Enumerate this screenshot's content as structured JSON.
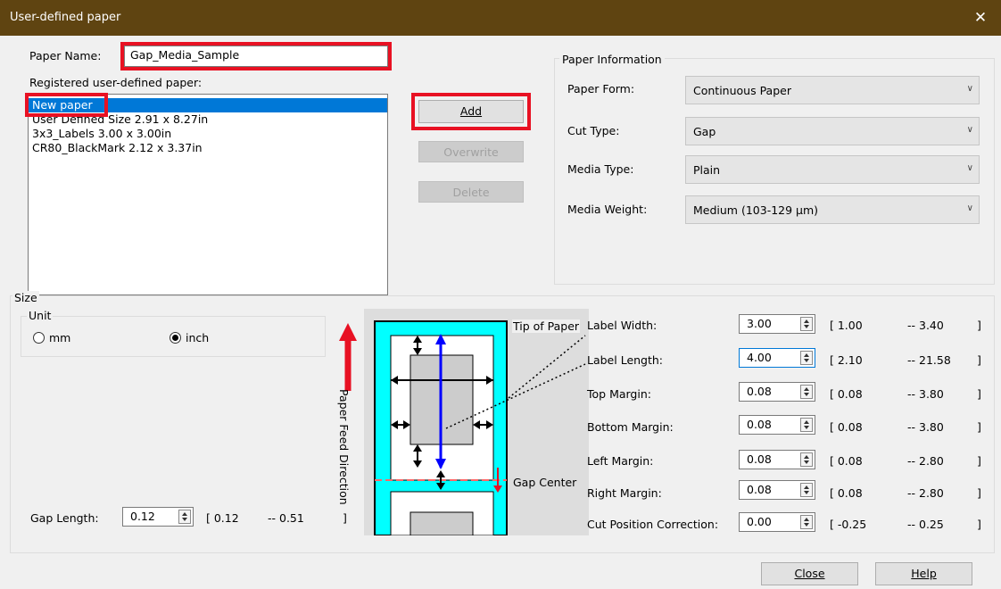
{
  "window": {
    "title": "User-defined paper",
    "close_glyph": "✕"
  },
  "paper_name": {
    "label": "Paper Name:",
    "value": "Gap_Media_Sample"
  },
  "registered": {
    "label": "Registered user-defined paper:",
    "items": [
      "New paper",
      "User Defined Size 2.91 x 8.27in",
      "3x3_Labels 3.00 x 3.00in",
      "CR80_BlackMark 2.12 x 3.37in"
    ]
  },
  "buttons": {
    "add": "Add",
    "overwrite": "Overwrite",
    "delete": "Delete",
    "close": "Close",
    "help": "Help"
  },
  "paper_info": {
    "title": "Paper Information",
    "paper_form": {
      "label": "Paper Form:",
      "value": "Continuous Paper"
    },
    "cut_type": {
      "label": "Cut Type:",
      "value": "Gap"
    },
    "media_type": {
      "label": "Media Type:",
      "value": "Plain"
    },
    "media_weight": {
      "label": "Media Weight:",
      "value": "Medium (103-129 μm)"
    }
  },
  "size": {
    "title": "Size",
    "unit": {
      "title": "Unit",
      "mm": "mm",
      "inch": "inch",
      "selected": "inch"
    },
    "gap_length": {
      "label": "Gap Length:",
      "value": "0.12",
      "min": "[  0.12",
      "max": "--  0.51",
      "close": "]"
    }
  },
  "diagram": {
    "tip_of_paper": "Tip of Paper",
    "gap_center": "Gap Center",
    "feed_direction": "Paper Feed Direction",
    "feed_color": "#e81123",
    "label_color": "#00ffff"
  },
  "fields": [
    {
      "label": "Label Width:",
      "value": "3.00",
      "min": "[  1.00",
      "max": "--  3.40",
      "close": "]"
    },
    {
      "label": "Label Length:",
      "value": "4.00",
      "min": "[  2.10",
      "max": "--  21.58",
      "close": "]"
    },
    {
      "label": "Top Margin:",
      "value": "0.08",
      "min": "[  0.08",
      "max": "--  3.80",
      "close": "]"
    },
    {
      "label": "Bottom Margin:",
      "value": "0.08",
      "min": "[  0.08",
      "max": "--  3.80",
      "close": "]"
    },
    {
      "label": "Left Margin:",
      "value": "0.08",
      "min": "[  0.08",
      "max": "--  2.80",
      "close": "]"
    },
    {
      "label": "Right Margin:",
      "value": "0.08",
      "min": "[  0.08",
      "max": "--  2.80",
      "close": "]"
    },
    {
      "label": "Cut Position Correction:",
      "value": "0.00",
      "min": "[  -0.25",
      "max": "--  0.25",
      "close": "]"
    }
  ]
}
